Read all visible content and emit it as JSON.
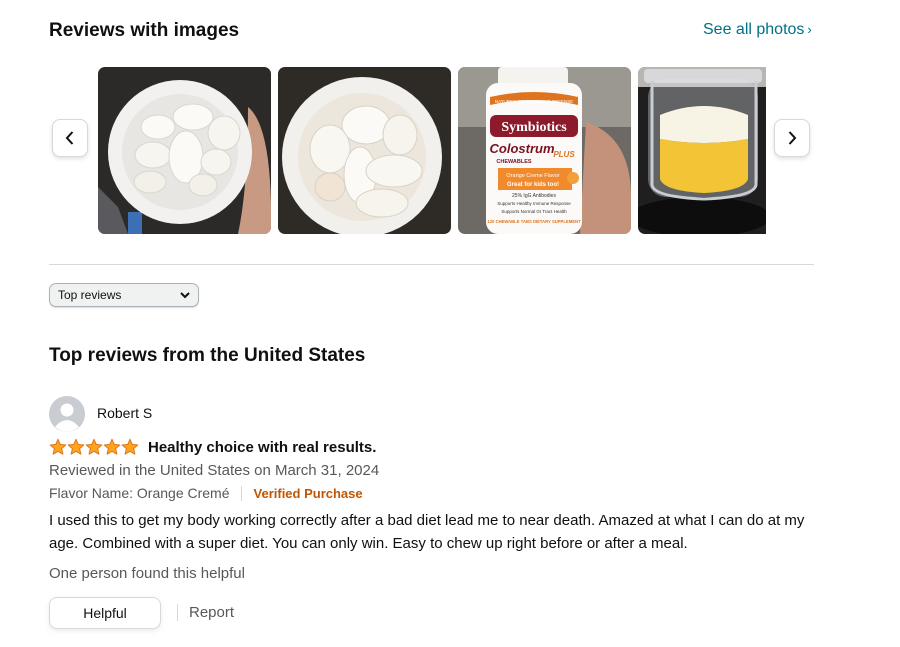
{
  "images_section": {
    "title": "Reviews with images",
    "see_all_label": "See all photos",
    "see_all_chevron": "›",
    "prev_icon": "chevron-left-icon",
    "next_icon": "chevron-right-icon",
    "thumbnails": [
      {
        "subject": "white-tablets-in-bottle"
      },
      {
        "subject": "white-tablets-in-bottle-closeup"
      },
      {
        "subject": "symbiotics-bottle-in-hand"
      },
      {
        "subject": "yellow-drink-in-glass-jar"
      }
    ],
    "product_label": {
      "brand": "Symbiotics",
      "name": "Colostrum",
      "suffix": "PLUS",
      "subtitle": "CHEWABLES",
      "flavor": "Orange Creme Flavor",
      "tagline": "Great for kids too!",
      "claims": [
        "25% IgG Antibodies",
        "Supports Healthy Immune Response",
        "Supports Normal GI Tract Health"
      ],
      "footer": "120 CHEWABLE TABS DIETARY SUPPLEMENT",
      "top_banner": "NATURE'S FIRST IMMUNE DEFENSE"
    }
  },
  "sort": {
    "selected": "Top reviews",
    "icon": "chevron-down-icon"
  },
  "reviews_section": {
    "title": "Top reviews from the United States"
  },
  "review": {
    "reviewer_name": "Robert S",
    "avatar_icon": "user-avatar-icon",
    "rating": 5,
    "rating_max": 5,
    "star_color": "#ffa41c",
    "star_outline": "#de7921",
    "title": "Healthy choice with real results.",
    "date_line": "Reviewed in the United States on March 31, 2024",
    "flavor_line": "Flavor Name: Orange Cremé",
    "verified_label": "Verified Purchase",
    "body": "I used this to get my body working correctly after a bad diet lead me to near death. Amazed at what I can do at my age. Combined with a super diet. You can only win. Easy to chew up right before or after a meal.",
    "helpful_count": "One person found this helpful",
    "helpful_button": "Helpful",
    "report_label": "Report"
  },
  "colors": {
    "link": "#007185",
    "verified": "#c45500",
    "secondary_text": "#565959",
    "divider": "#d5d9d9"
  }
}
